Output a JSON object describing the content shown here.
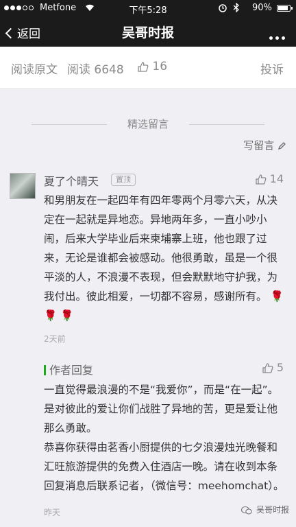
{
  "status": {
    "carrier": "Metfone",
    "time": "下午5:28",
    "battery_percent": "90%",
    "battery_level": 0.9,
    "signal_dots_filled": 3,
    "signal_dots_total": 5
  },
  "nav": {
    "back_label": "返回",
    "title": "吴哥时报",
    "more_icon": "more-icon"
  },
  "article": {
    "original_link": "阅读原文",
    "reads": "阅读 6648",
    "likes": "16",
    "report": "投诉"
  },
  "comments_section": {
    "header": "精选留言",
    "write_label": "写留言"
  },
  "comment": {
    "author": "夏了个晴天",
    "pinned": "置顶",
    "likes": "14",
    "text": "和男朋友在一起四年有四年零两个月零六天，从决定在一起就是异地恋。异地两年多，一直小吵小闹，后来大学毕业后来柬埔寨上班，他也跟了过来，无论是谁都会被感动。他很勇敢，虽是一个很平淡的人，不浪漫不表现，但会默默地守护我，为我付出。彼此相爱，一切都不容易，感谢所有。",
    "roses": "🌹 🌹 🌹",
    "time": "2天前"
  },
  "reply": {
    "label": "作者回复",
    "likes": "5",
    "paragraph1": "一直觉得最浪漫的不是“我爱你”，而是“在一起”。是对彼此的爱让你们战胜了异地的苦，更是爱让他那么勇敢。",
    "paragraph2": "恭喜你获得由茗香小厨提供的七夕浪漫烛光晚餐和汇旺旅游提供的免费入住酒店一晚。请在收到本条回复消息后联系记者，（微信号：meehomchat）。",
    "time": "昨天"
  },
  "watermark": {
    "text": "吴哥时报"
  },
  "colors": {
    "header_bg": "#1b1b1b",
    "reply_accent": "#1aad19",
    "rose": "#c43a3a"
  }
}
